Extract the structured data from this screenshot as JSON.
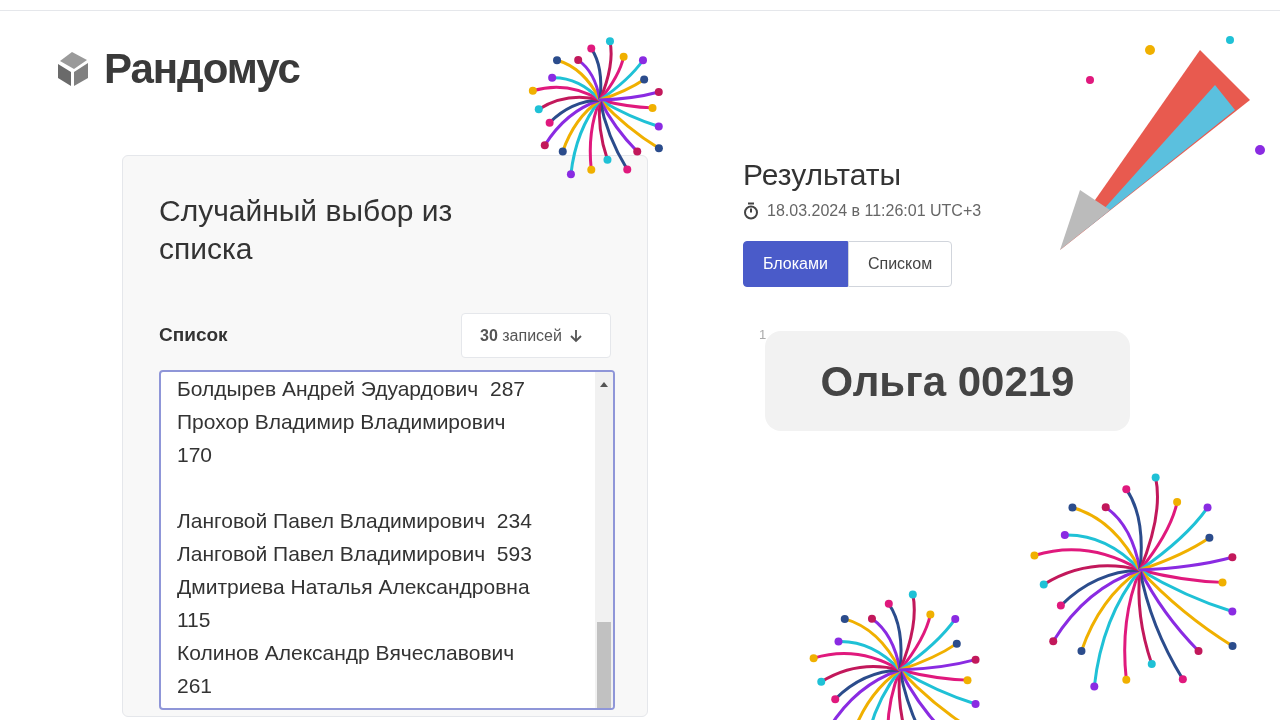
{
  "logo": {
    "text": "Рандомус"
  },
  "form": {
    "title": "Случайный выбор из списка",
    "list_label": "Список",
    "count_dropdown": "**30** записей",
    "lines": [
      {
        "text": "Болдырев Андрей Эдуардович  287",
        "space_before": false
      },
      {
        "text": "Прохор Владимир Владимирович",
        "space_before": false
      },
      {
        "text": "170",
        "space_before": false
      },
      {
        "text": "Ланговой Павел Владимирович  234",
        "space_before": true
      },
      {
        "text": "Ланговой Павел Владимирович  593",
        "space_before": false
      },
      {
        "text": "Дмитриева Наталья Александровна",
        "space_before": false
      },
      {
        "text": "115",
        "space_before": false
      },
      {
        "text": "Колинов Александр Вячеславович",
        "space_before": false
      },
      {
        "text": "261",
        "space_before": false
      }
    ]
  },
  "results": {
    "title": "Результаты",
    "timestamp": "18.03.2024 в 11:26:01 UTC+3",
    "tabs": [
      {
        "label": "Блоками",
        "selected": true
      },
      {
        "label": "Списком",
        "selected": false
      }
    ],
    "items": [
      {
        "number": "1",
        "value": "Ольга 00219"
      }
    ]
  }
}
